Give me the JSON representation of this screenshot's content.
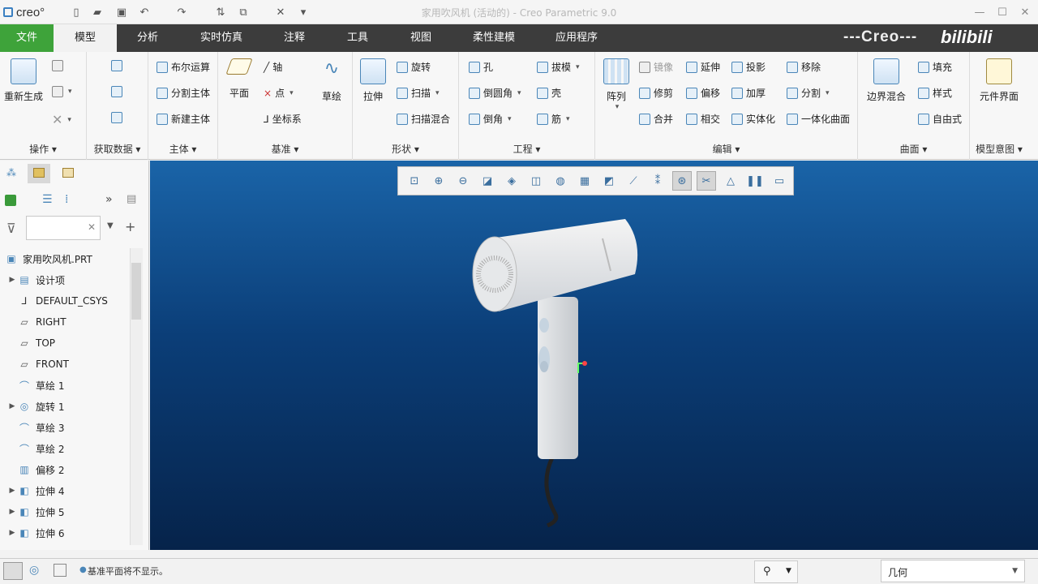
{
  "app": {
    "logo": "creo°",
    "window_title": "家用吹风机 (活动的) - Creo Parametric 9.0"
  },
  "tabs": [
    "文件",
    "模型",
    "分析",
    "实时仿真",
    "注释",
    "工具",
    "视图",
    "柔性建模",
    "应用程序"
  ],
  "brand": "---Creo---",
  "watermark": "bilibili",
  "ribbon": {
    "ops": {
      "label": "操作",
      "regen": "重新生成"
    },
    "getdata": {
      "label": "获取数据"
    },
    "body": {
      "label": "主体",
      "bool": "布尔运算",
      "split": "分割主体",
      "newbody": "新建主体"
    },
    "datum": {
      "label": "基准",
      "plane": "平面",
      "axis": "轴",
      "point": "点",
      "csys": "坐标系",
      "sketch": "草绘"
    },
    "shape": {
      "label": "形状",
      "extrude": "拉伸",
      "revolve": "旋转",
      "sweep": "扫描",
      "sweepblend": "扫描混合"
    },
    "eng": {
      "label": "工程",
      "hole": "孔",
      "round": "倒圆角",
      "chamfer": "倒角",
      "draft": "拔模",
      "shell": "壳",
      "rib": "筋"
    },
    "edit": {
      "label": "编辑",
      "pattern": "阵列",
      "mirror": "镜像",
      "trim": "修剪",
      "merge": "合并",
      "extend": "延伸",
      "offset": "偏移",
      "intersect": "相交",
      "project": "投影",
      "thicken": "加厚",
      "solidify": "实体化",
      "remove": "移除",
      "split": "分割",
      "unify": "一体化曲面"
    },
    "surf": {
      "label": "曲面",
      "boundary": "边界混合",
      "fill": "填充",
      "style": "样式",
      "freestyle": "自由式"
    },
    "intent": {
      "label": "模型意图",
      "component": "元件界面"
    }
  },
  "tree": {
    "root": "家用吹风机.PRT",
    "items": [
      "设计项",
      "DEFAULT_CSYS",
      "RIGHT",
      "TOP",
      "FRONT",
      "草绘 1",
      "旋转 1",
      "草绘 3",
      "草绘 2",
      "偏移 2",
      "拉伸 4",
      "拉伸 5",
      "拉伸 6"
    ]
  },
  "status": {
    "message": "基准平面将不显示。",
    "filter": "几何"
  }
}
